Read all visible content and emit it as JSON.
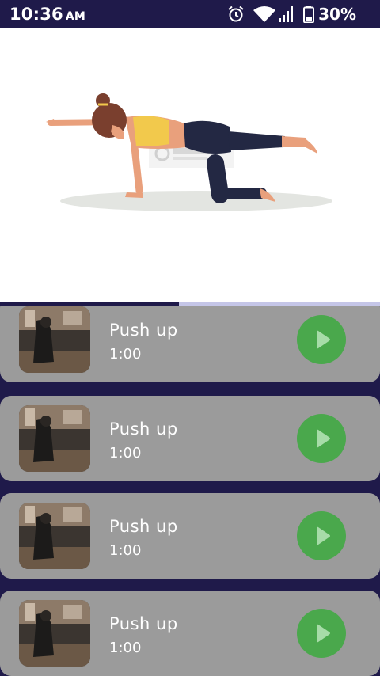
{
  "status_bar": {
    "time": "10:36",
    "ampm": "AM",
    "battery": "30%",
    "icons": [
      "alarm-icon",
      "wifi-icon",
      "signal-icon",
      "battery-icon"
    ]
  },
  "hero": {
    "image": "woman doing bird-dog exercise illustration",
    "watermark": "IconScout"
  },
  "progress": {
    "fraction": 0.47
  },
  "exercises": [
    {
      "title": "Push up",
      "duration": "1:00"
    },
    {
      "title": "Push up",
      "duration": "1:00"
    },
    {
      "title": "Push up",
      "duration": "1:00"
    },
    {
      "title": "Push up",
      "duration": "1:00"
    }
  ],
  "colors": {
    "status_bar": "#1f1a4a",
    "background": "#1f1a4a",
    "card": "#9b9b9b",
    "play_button": "#4aa84c",
    "progress_track": "#c5c6e8"
  }
}
